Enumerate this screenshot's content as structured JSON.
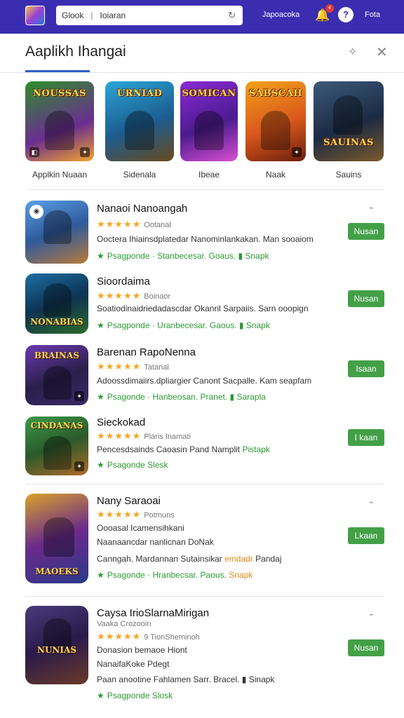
{
  "topbar": {
    "search_left": "Glook",
    "search_right": "Ioiaran",
    "link1": "Japoacoka",
    "notif_count": "4",
    "link2": "Fota"
  },
  "panel": {
    "title": "Aaplikh Ihangai"
  },
  "featured": [
    {
      "tile": "NOUSSAS",
      "label": "Applkin Nuaan",
      "bg": "linear-gradient(160deg,#2d8f2a,#6a2d91 60%,#f2a42a)"
    },
    {
      "tile": "URNIAD",
      "label": "Sidenala",
      "bg": "linear-gradient(160deg,#2aa6d6,#1c5c8f 55%,#6a4a1e)"
    },
    {
      "tile": "SOMICAN",
      "label": "Ibeae",
      "bg": "linear-gradient(160deg,#8a2bd6,#4b1b8f 55%,#d94fd0)"
    },
    {
      "tile": "SABSCAH",
      "label": "Naak",
      "bg": "linear-gradient(160deg,#f2a21a,#d9571b 55%,#6a1f0f)"
    },
    {
      "tile": "SAUINAS",
      "label": "Sauins",
      "bg": "linear-gradient(160deg,#3b5a7a,#1c2a44 55%,#7a5a2a)"
    }
  ],
  "apps": [
    {
      "title": "Nanaoi Nanoangah",
      "stars": "★★★★★",
      "rating_text": "Ootanal",
      "desc": "Ooctera Ihiainsdplatedar Nanominlankakan. Man sooaiom",
      "meta": "Psagponde · Stanbecesar. Goaus. ▮ Snapk",
      "button": "Nusan",
      "thumb_text": "",
      "bg": "linear-gradient(160deg,#5aa0e6,#2f5a9c 50%,#b87a3a)"
    },
    {
      "title": "Sioordaima",
      "stars": "★★★★★",
      "rating_text": "Boinaor",
      "desc": "Soatiodinaidriedadascdar Okanril Sarpaiis. Sarn ooopign",
      "meta": "Psagponde · Uranbecesar. Gaous. ▮ Snapk",
      "button": "Nusan",
      "thumb_text": "NONABIAS",
      "bg": "linear-gradient(160deg,#1d6fa3,#0e3352 50%,#2b6a2a)"
    },
    {
      "title": "Barenan RapoNenna",
      "stars": "★★★★★",
      "rating_text": "Tatanal",
      "desc": "Adoossdimaiirs.dpliargier Canont Sacpalle. Kam seapfam",
      "meta": "Psagonde · Hanbeosan. Pranet. ▮ Sarapla",
      "button": "Isaan",
      "thumb_text": "BRAINAS",
      "bg": "linear-gradient(160deg,#6a3ab0,#2a1f4a 55%,#3a2a6a)"
    },
    {
      "title": "Sieckokad",
      "stars": "★★★★★",
      "rating_text": "Plaris Inamati",
      "desc": "Pencesdsainds Caoasin Pand Namplit",
      "desc_green": "Pistapk",
      "meta": "Psagonde Slesk",
      "button": "I kaan",
      "thumb_text": "CINDANAS",
      "bg": "linear-gradient(160deg,#3a9a4a,#2a5a2a 50%,#b06a2a)"
    },
    {
      "title": "Nany Saraoai",
      "stars": "★★★★★",
      "rating_text": "Potmuns",
      "desc": "Oooasal Icamensihkani",
      "desc2": "Naanaancdar nanlicnan DoNak",
      "desc3": "Canngah. Mardannan Sutainsikar",
      "desc3_green": "emdadr",
      "desc3_tail": "Pandaj",
      "meta": "Psagonde · Hranbecsar. Paous.",
      "meta_tail": "Snapk",
      "button": "Lkaan",
      "thumb_text": "MAOEKS",
      "bg": "linear-gradient(160deg,#d9a22a,#6a2a8a 50%,#2a3a8a)"
    },
    {
      "title": "Caysa IrioSlarnaMirigan",
      "sub_stars": "Vaaka Crozooin",
      "stars": "★★★★★",
      "rating_text": "9 TionSheminoh",
      "desc": "Donasion bemaoe Hiont",
      "desc2": "NanaifaKoke Pdegt",
      "desc3": "Paan anootine Fahlamen Sarr. Bracel. ▮ Sinapk",
      "meta": "Psagponde Slosk",
      "button": "Nusan",
      "thumb_text": "NUNIAS",
      "bg": "linear-gradient(160deg,#4a3a7a,#2a1a4a 50%,#6a3a2a)"
    }
  ]
}
